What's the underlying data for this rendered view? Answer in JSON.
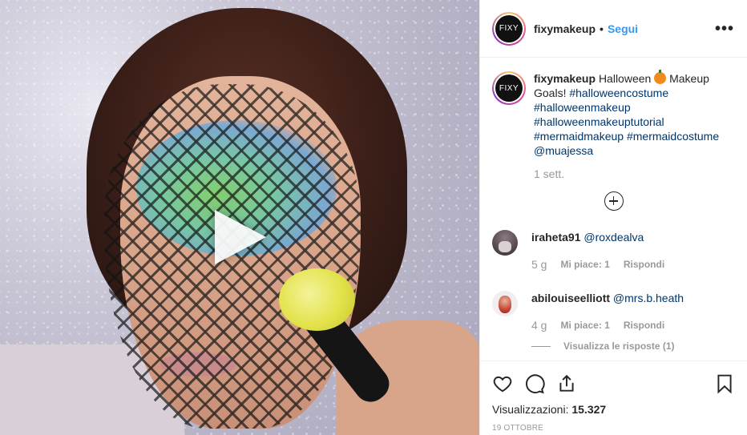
{
  "post": {
    "media": {
      "play_label": "play-icon"
    },
    "header": {
      "username": "fixymakeup",
      "separator": "•",
      "follow_label": "Segui",
      "more_icon": "more-options-icon",
      "avatar_text": "FIXY"
    },
    "caption": {
      "username": "fixymakeup",
      "text_before_emoji": "Halloween",
      "emoji": "jack-o-lantern",
      "text_after_emoji": "Makeup Goals!",
      "hashtags": [
        "#halloweencostume",
        "#halloweenmakeup",
        "#halloweenmakeuptutorial",
        "#mermaidmakeup",
        "#mermaidcostume"
      ],
      "mention": "@muajessa",
      "time_ago": "1 sett."
    },
    "load_more_icon": "plus-circle-icon",
    "comments": [
      {
        "username": "iraheta91",
        "text": "@roxdealva",
        "age": "5 g",
        "likes": "Mi piace: 1",
        "reply_label": "Rispondi"
      },
      {
        "username": "abilouiseelliott",
        "text": "@mrs.b.heath",
        "age": "4 g",
        "likes": "Mi piace: 1",
        "reply_label": "Rispondi",
        "view_replies": "Visualizza le risposte (1)"
      }
    ],
    "actions": {
      "icons": [
        "heart-icon",
        "comment-icon",
        "share-icon",
        "bookmark-icon"
      ],
      "views_label": "Visualizzazioni:",
      "views_count": "15.327",
      "date": "19 OTTOBRE"
    },
    "colors": {
      "link_blue": "#3897f0",
      "hashtag_blue": "#003569",
      "muted_gray": "#999999"
    }
  }
}
